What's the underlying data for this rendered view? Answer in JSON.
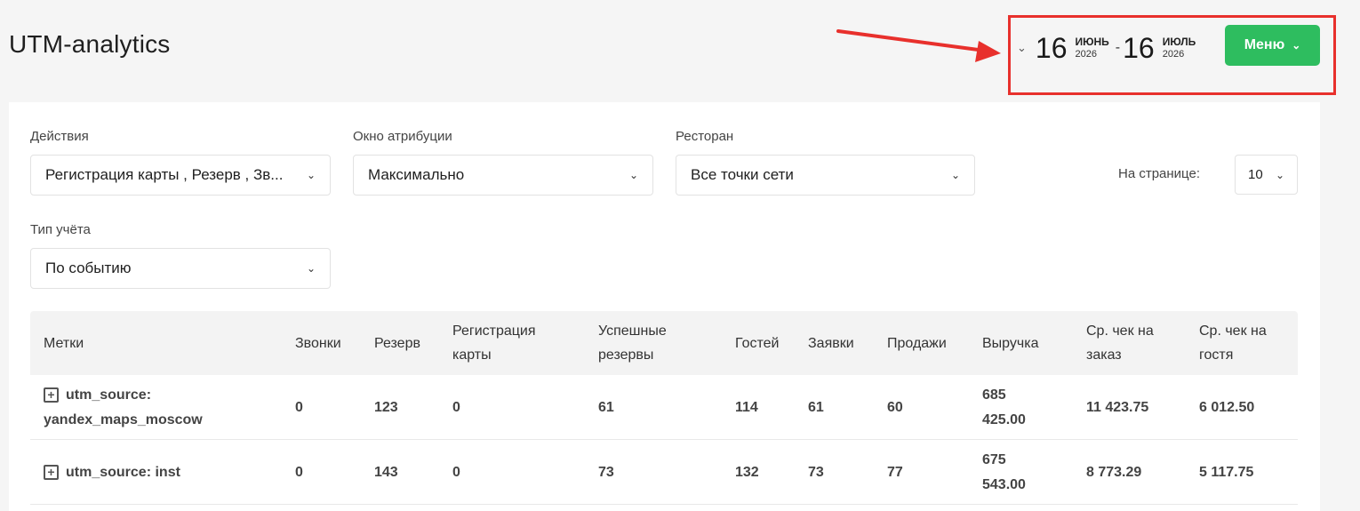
{
  "page": {
    "title": "UTM-analytics"
  },
  "date_range": {
    "from": {
      "day": "16",
      "month": "ИЮНЬ",
      "year": "2026"
    },
    "separator": "-",
    "to": {
      "day": "16",
      "month": "ИЮЛЬ",
      "year": "2026"
    }
  },
  "menu": {
    "label": "Меню"
  },
  "filters": {
    "actions": {
      "label": "Действия",
      "value": "Регистрация карты , Резерв , Зв..."
    },
    "attribution_window": {
      "label": "Окно атрибуции",
      "value": "Максимально"
    },
    "restaurant": {
      "label": "Ресторан",
      "value": "Все точки сети"
    },
    "accounting_type": {
      "label": "Тип учёта",
      "value": "По событию"
    },
    "per_page": {
      "label": "На странице:",
      "value": "10"
    }
  },
  "table": {
    "headers": [
      "Метки",
      "Звонки",
      "Резерв",
      "Регистрация карты",
      "Успешные резервы",
      "Гостей",
      "Заявки",
      "Продажи",
      "Выручка",
      "Ср. чек на заказ",
      "Ср. чек на гостя"
    ],
    "rows": [
      [
        "utm_source: yandex_maps_moscow",
        "0",
        "123",
        "0",
        "61",
        "114",
        "61",
        "60",
        "685 425.00",
        "11 423.75",
        "6 012.50"
      ],
      [
        "utm_source: inst",
        "0",
        "143",
        "0",
        "73",
        "132",
        "73",
        "77",
        "675 543.00",
        "8 773.29",
        "5 117.75"
      ]
    ]
  },
  "colors": {
    "accent": "#2ebd5f",
    "annotation": "#e8302c"
  }
}
